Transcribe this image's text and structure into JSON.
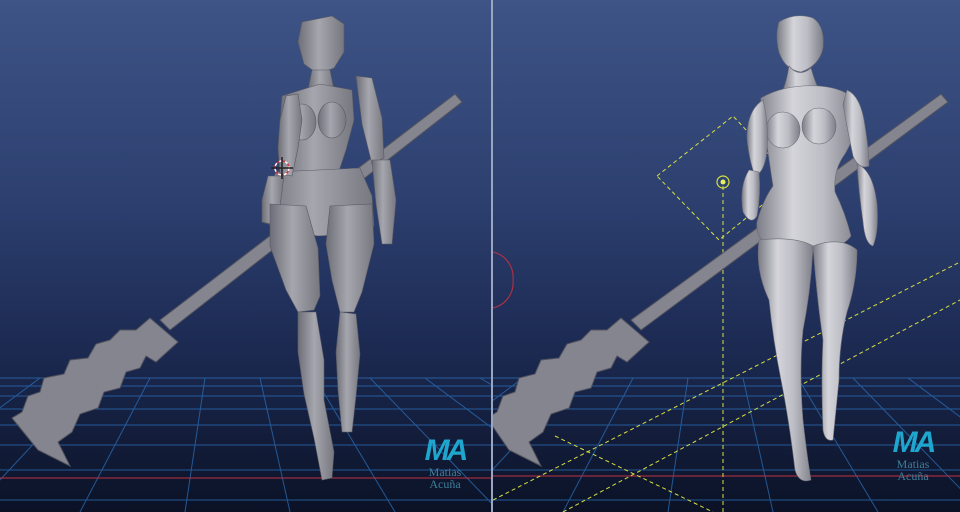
{
  "viewports": {
    "left": {
      "shading": "flat"
    },
    "right": {
      "shading": "smooth"
    }
  },
  "watermark": {
    "logo": "MA",
    "first_name": "Matias",
    "last_name": "Acuña"
  },
  "colors": {
    "background_top": "#3e5486",
    "background_bottom": "#0b1226",
    "grid": "#2c74c0",
    "model": "#9c9ca4",
    "cursor": "#cc3344",
    "camera": "#d8e040"
  }
}
